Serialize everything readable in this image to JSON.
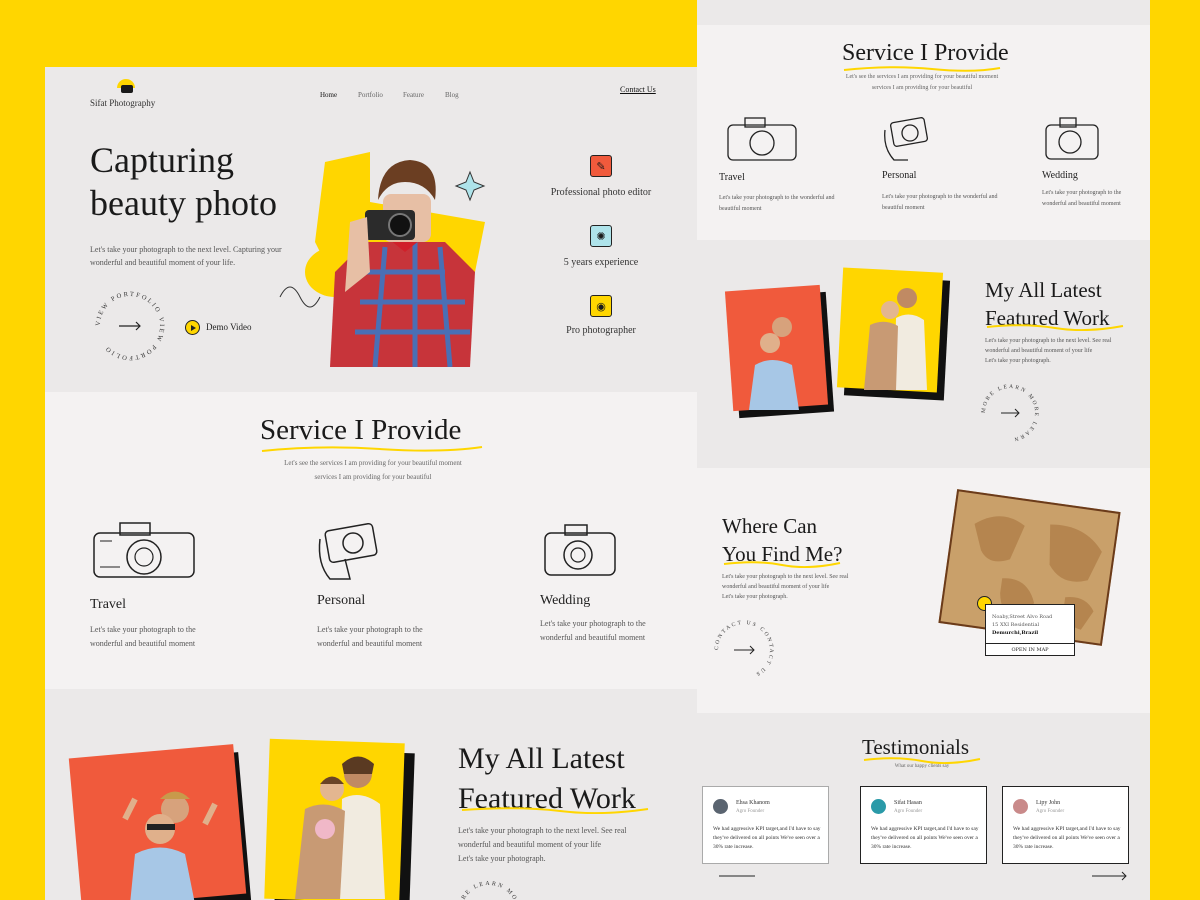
{
  "brand": {
    "name": "Sifat Photography",
    "accent": "#FFD600",
    "coral": "#F05A3C"
  },
  "nav": {
    "home": "Home",
    "portfolio": "Portfolio",
    "feature": "Feature",
    "blog": "Blog",
    "contact": "Contact Us"
  },
  "hero": {
    "title_line1": "Capturing",
    "title_line2": "beauty photo",
    "desc": "Let's take your photograph to the next level. Capturing your wonderful and beautiful moment of your life.",
    "ring_text": "VIEW PORTFOLIO VIEW PORTFOLIO",
    "demo_label": "Demo Video",
    "features": [
      {
        "icon": "brush-icon",
        "label": "Professional photo editor"
      },
      {
        "icon": "badge-icon",
        "label": "5 years experience"
      },
      {
        "icon": "camera-icon",
        "label": "Pro photographer"
      }
    ]
  },
  "services": {
    "title": "Service I Provide",
    "sub1": "Let's see the services I am providing for your beautiful moment",
    "sub2": "services I am providing for your beautiful",
    "items": [
      {
        "name": "Travel",
        "desc": "Let's take your photograph to the wonderful and beautiful moment"
      },
      {
        "name": "Personal",
        "desc": "Let's take your photograph to the wonderful and beautiful moment"
      },
      {
        "name": "Wedding",
        "desc": "Let's take your photograph to the wonderful and beautiful moment"
      }
    ]
  },
  "work": {
    "title_line1": "My All Latest",
    "title_line2": "Featured Work",
    "desc1": "Let's take your photograph to the next level. See real",
    "desc2": "wonderful and beautiful moment of your life",
    "desc3": "Let's take your photograph.",
    "ring_text": "MORE LEARN MORE LEARN"
  },
  "find": {
    "title_line1": "Where Can",
    "title_line2": "You Find Me?",
    "desc1": "Let's take your photograph to the next level. See real",
    "desc2": "wonderful and beautiful moment of your life",
    "desc3": "Let's take your photograph.",
    "ring_text": "CONTACT US CONTACT US",
    "address1": "Noaby,Street Alvo Road",
    "address2": "15 XXI Residential",
    "address3": "Demurchi,Brazil",
    "open_map": "OPEN IN MAP"
  },
  "testimonials": {
    "title": "Testimonials",
    "sub": "What our happy clients say",
    "items": [
      {
        "name": "Ehsa Khanom",
        "role": "Agro Founder",
        "text": "We had aggressive KPI target,and I'd have to say they've delivered on all points We've seen over a 30% rate increase."
      },
      {
        "name": "Sifat Hasan",
        "role": "Agro Founder",
        "text": "We had aggressive KPI target,and I'd have to say they've delivered on all points We've seen over a 30% rate increase."
      },
      {
        "name": "Lipy John",
        "role": "Agro Founder",
        "text": "We had aggressive KPI target,and I'd have to say they've delivered on all points We've seen over a 30% rate increase."
      }
    ]
  }
}
